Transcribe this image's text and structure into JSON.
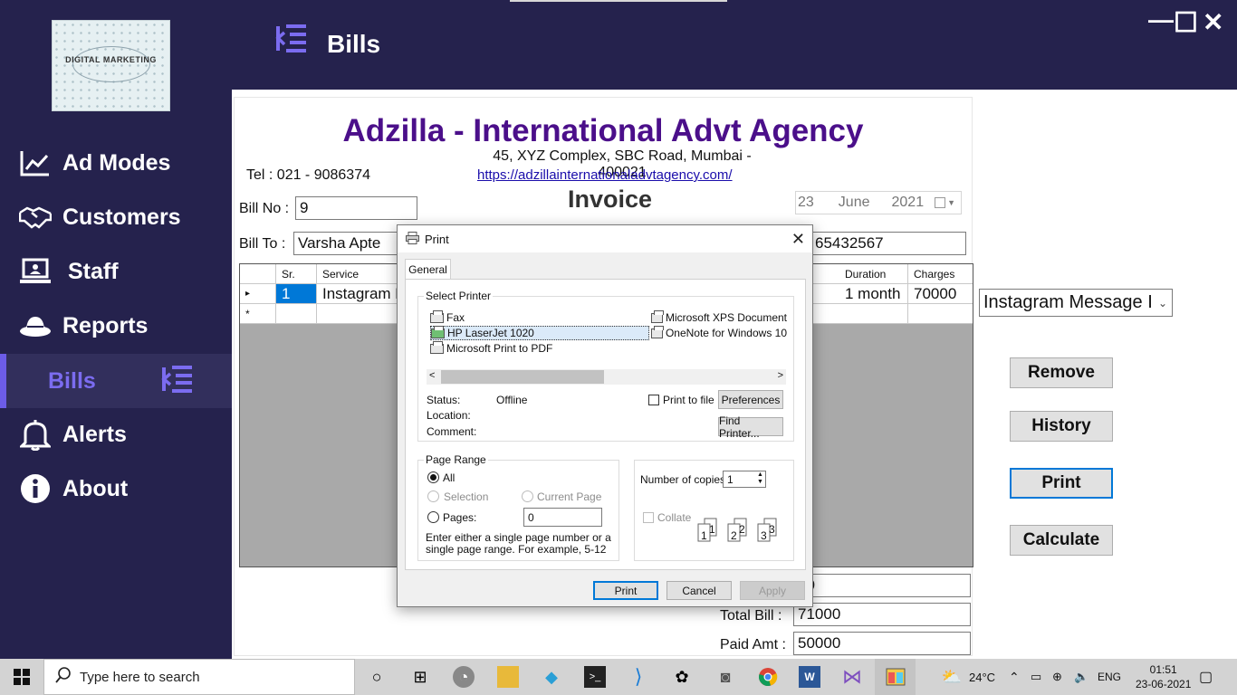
{
  "sidebar": {
    "logo_text": "DIGITAL MARKETING",
    "items": [
      {
        "label": "Ad Modes",
        "icon": "line-chart-icon"
      },
      {
        "label": "Customers",
        "icon": "handshake-icon"
      },
      {
        "label": "Staff",
        "icon": "laptop-user-icon"
      },
      {
        "label": "Reports",
        "icon": "hat-icon"
      },
      {
        "label": "Bills",
        "icon": "menu-collapse-icon",
        "active": true
      },
      {
        "label": "Alerts",
        "icon": "bell-icon"
      },
      {
        "label": "About",
        "icon": "info-icon"
      }
    ],
    "accent": "#6c5ce7"
  },
  "header": {
    "title": "Bills"
  },
  "window_controls": {
    "minimize": "—",
    "maximize": "☐",
    "close": "✕"
  },
  "invoice": {
    "company": "Adzilla - International Advt Agency",
    "address": "45, XYZ Complex, SBC Road, Mumbai - 400021",
    "tel": "Tel : 021 - 9086374",
    "website": "https://adzillainternationaladvtagency.com/",
    "title": "Invoice",
    "date": {
      "day": "23",
      "month": "June",
      "year": "2021"
    },
    "bill_no_label": "Bill No :",
    "bill_no": "9",
    "bill_to_label": "Bill To :",
    "bill_to": "Varsha Apte",
    "phone_partial": "65432567",
    "grid": {
      "columns": [
        "Sr.",
        "Service",
        "Duration",
        "Charges"
      ],
      "rows": [
        {
          "indicator": "▸",
          "sr": "1",
          "service": "Instagram M",
          "duration": "1 month",
          "charges": "70000"
        },
        {
          "indicator": "*",
          "sr": "",
          "service": "",
          "duration": "",
          "charges": ""
        }
      ]
    },
    "partial_amount": "00",
    "total_label": "Total Bill :",
    "total": "71000",
    "paid_label": "Paid Amt :",
    "paid": "50000",
    "company_color": "#4b0f8a"
  },
  "service_combo": {
    "selected": "Instagram Message I"
  },
  "actions": {
    "remove": "Remove",
    "history": "History",
    "print": "Print",
    "calculate": "Calculate"
  },
  "print_dialog": {
    "title": "Print",
    "tab": "General",
    "select_printer_label": "Select Printer",
    "printers": [
      "Fax",
      "HP LaserJet 1020",
      "Microsoft Print to PDF",
      "Microsoft XPS Document",
      "OneNote for Windows 10"
    ],
    "selected_printer": "HP LaserJet 1020",
    "status_label": "Status:",
    "status_value": "Offline",
    "location_label": "Location:",
    "comment_label": "Comment:",
    "print_to_file": "Print to file",
    "preferences": "Preferences",
    "find_printer": "Find Printer...",
    "page_range_label": "Page Range",
    "range_all": "All",
    "range_selection": "Selection",
    "range_current": "Current Page",
    "range_pages": "Pages:",
    "pages_value": "0",
    "range_hint": "Enter either a single page number or a single page range.  For example, 5-12",
    "copies_label": "Number of copies:",
    "copies_value": "1",
    "collate": "Collate",
    "buttons": {
      "print": "Print",
      "cancel": "Cancel",
      "apply": "Apply"
    }
  },
  "taskbar": {
    "search_placeholder": "Type here to search",
    "weather": "24°C",
    "language": "ENG",
    "time": "01:51",
    "date": "23-06-2021"
  }
}
